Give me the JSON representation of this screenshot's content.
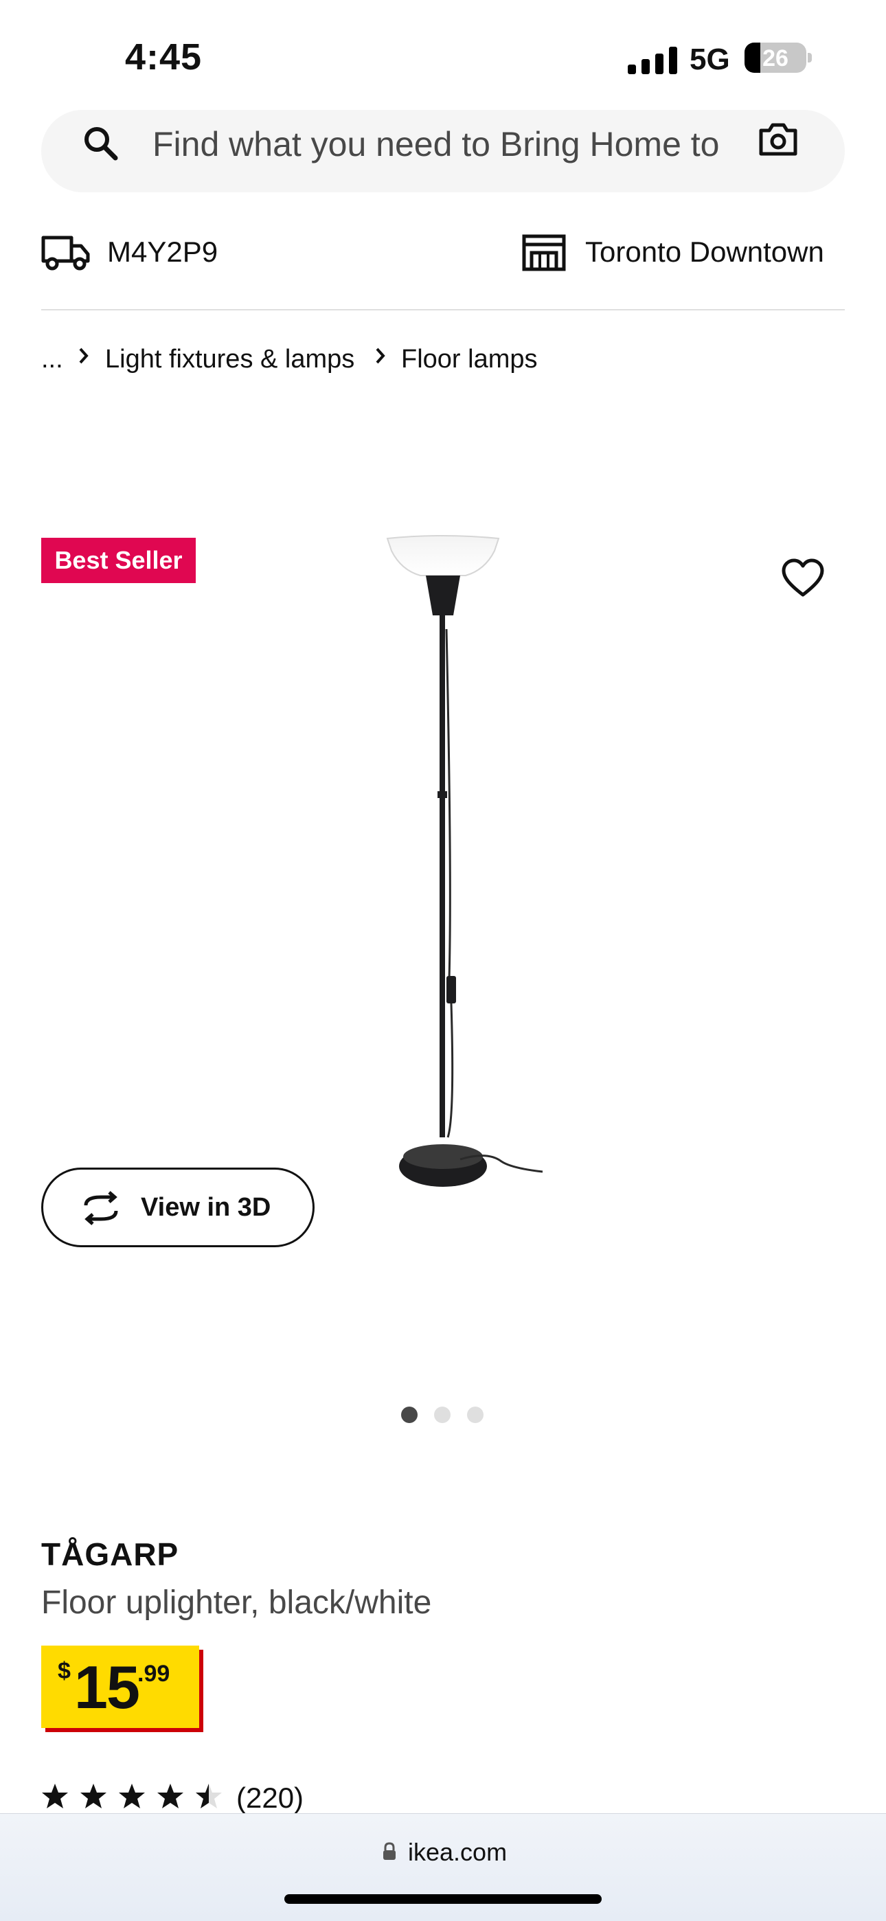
{
  "status": {
    "time": "4:45",
    "network": "5G",
    "battery": "26"
  },
  "search": {
    "placeholder": "Find what you need to Bring Home to"
  },
  "location": {
    "postal_code": "M4Y2P9",
    "store": "Toronto Downtown"
  },
  "breadcrumb": {
    "ellipsis": "...",
    "items": [
      "Light fixtures & lamps",
      "Floor lamps"
    ]
  },
  "product": {
    "badge": "Best Seller",
    "view_3d_label": "View in 3D",
    "name": "TÅGARP",
    "description": "Floor uplighter, black/white",
    "price": {
      "currency": "$",
      "integer": "15",
      "decimal": ".99"
    },
    "rating": 4.5,
    "reviews": "(220)",
    "image_dots": {
      "count": 3,
      "active": 0
    }
  },
  "browser": {
    "url": "ikea.com"
  },
  "colors": {
    "badge": "#e00751",
    "price_bg": "#ffdb00",
    "price_shadow": "#cc0008"
  }
}
